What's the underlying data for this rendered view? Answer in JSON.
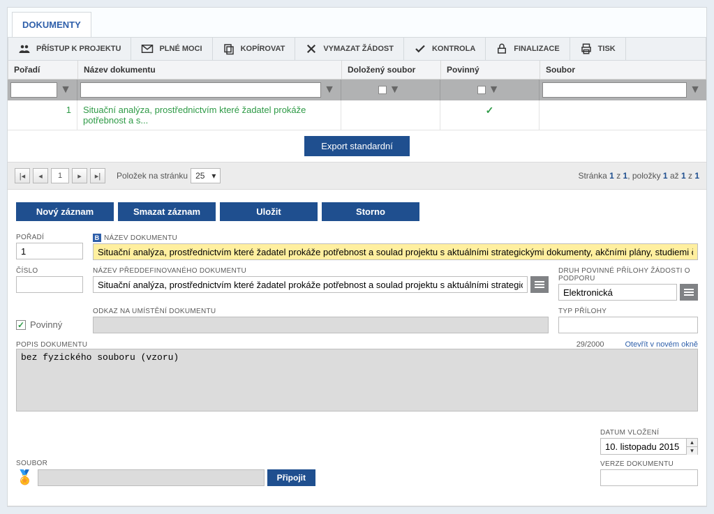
{
  "tabs": {
    "documents": "DOKUMENTY"
  },
  "toolbar": {
    "access": "PŘÍSTUP K PROJEKTU",
    "poa": "PLNÉ MOCI",
    "copy": "KOPÍROVAT",
    "delete": "VYMAZAT ŽÁDOST",
    "check": "KONTROLA",
    "finalize": "FINALIZACE",
    "print": "TISK"
  },
  "grid": {
    "headers": {
      "order": "Pořadí",
      "name": "Název dokumentu",
      "attached": "Doložený soubor",
      "mandatory": "Povinný",
      "file": "Soubor"
    },
    "row": {
      "order": "1",
      "name": "Situační analýza, prostřednictvím které žadatel prokáže potřebnost a s...",
      "attached": "",
      "mandatory_check": true,
      "file": ""
    },
    "export": "Export standardní"
  },
  "pager": {
    "page": "1",
    "per_label": "Položek na stránku",
    "per_value": "25",
    "right_prefix": "Stránka ",
    "right_p": "1",
    "right_of": " z ",
    "right_pt": "1",
    "right_items": ", položky ",
    "right_from": "1",
    "right_to_lab": " až ",
    "right_to": "1",
    "right_tot_lab": " z ",
    "right_tot": "1"
  },
  "buttons": {
    "new": "Nový záznam",
    "del": "Smazat záznam",
    "save": "Uložit",
    "cancel": "Storno"
  },
  "form": {
    "order_label": "POŘADÍ",
    "order": "1",
    "name_label": "NÁZEV DOKUMENTU",
    "name": "Situační analýza, prostřednictvím které žadatel prokáže potřebnost a soulad projektu s aktuálními strategickými dokumenty, akčními plány, studiemi či",
    "number_label": "ČÍSLO",
    "predef_label": "NÁZEV PŘEDDEFINOVANÉHO DOKUMENTU",
    "predef": "Situační analýza, prostřednictvím které žadatel prokáže potřebnost a soulad projektu s aktuálními strategickými ...",
    "druh_label": "DRUH POVINNÉ PŘÍLOHY ŽÁDOSTI O PODPORU",
    "druh": "Elektronická",
    "mandatory_label": "Povinný",
    "link_label": "ODKAZ NA UMÍSTĚNÍ DOKUMENTU",
    "type_label": "TYP PŘÍLOHY",
    "desc_label": "POPIS DOKUMENTU",
    "desc": "bez fyzického souboru (vzoru)",
    "counter": "29/2000",
    "open_new": "Otevřít v novém okně",
    "file_label": "SOUBOR",
    "attach": "Připojit",
    "date_label": "DATUM VLOŽENÍ",
    "date": "10. listopadu 2015",
    "version_label": "VERZE DOKUMENTU"
  }
}
